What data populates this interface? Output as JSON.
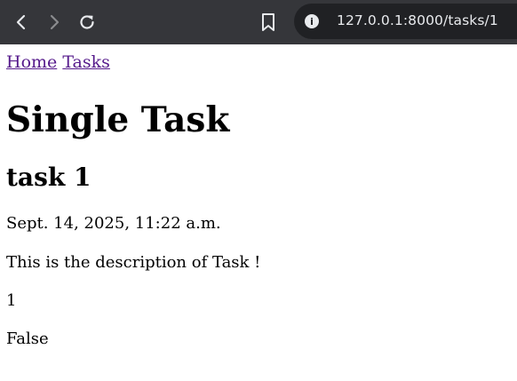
{
  "browser": {
    "url": "127.0.0.1:8000/tasks/1"
  },
  "nav": {
    "home_label": "Home",
    "tasks_label": "Tasks"
  },
  "page": {
    "title": "Single Task",
    "task_name": "task 1",
    "created": "Sept. 14, 2025, 11:22 a.m.",
    "description": "This is the description of Task !",
    "number": "1",
    "completed": "False"
  },
  "colors": {
    "toolbar_bg": "#35363a",
    "omnibox_bg": "#202124",
    "link_visited": "#551a8b"
  }
}
